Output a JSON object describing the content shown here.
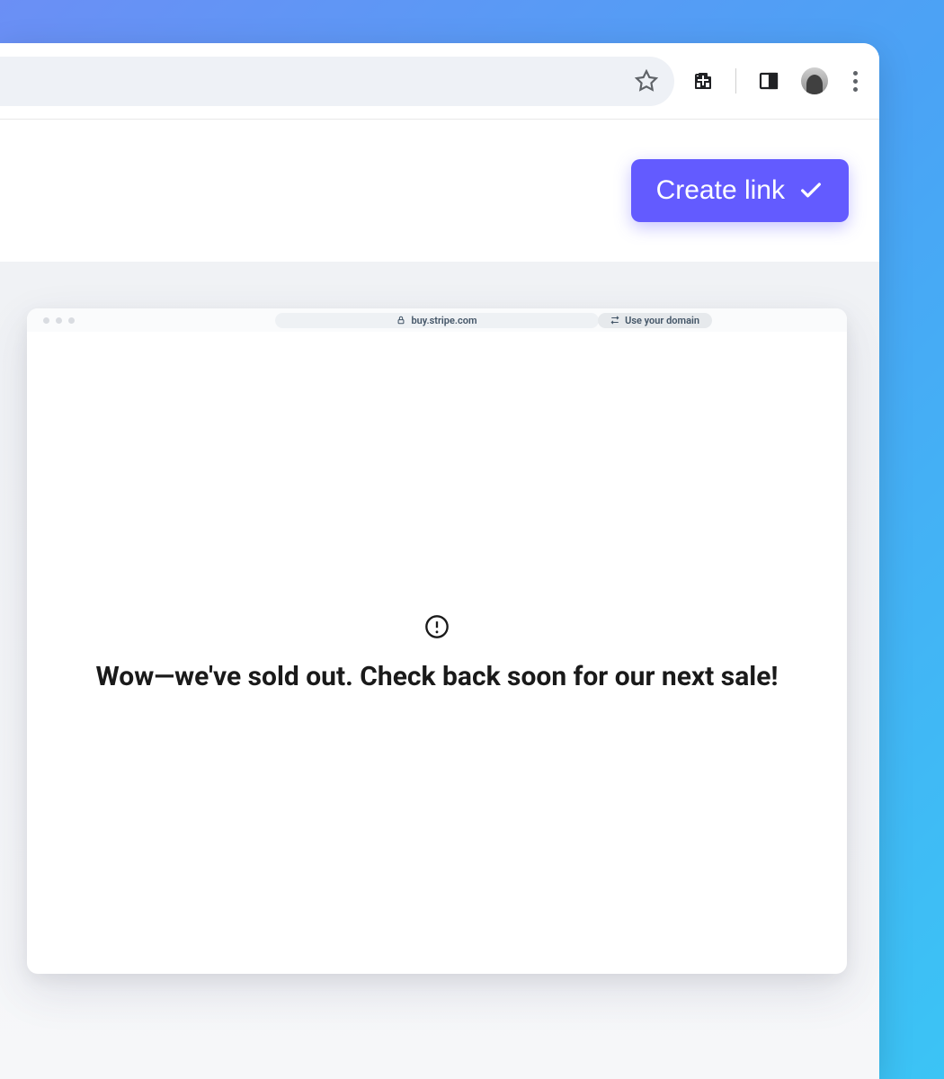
{
  "header": {
    "create_button_label": "Create link"
  },
  "preview": {
    "mock_url": "buy.stripe.com",
    "use_domain_label": "Use your domain",
    "soldout_message": "Wow—we've sold out. Check back soon for our next sale!"
  },
  "colors": {
    "accent": "#635bff"
  }
}
